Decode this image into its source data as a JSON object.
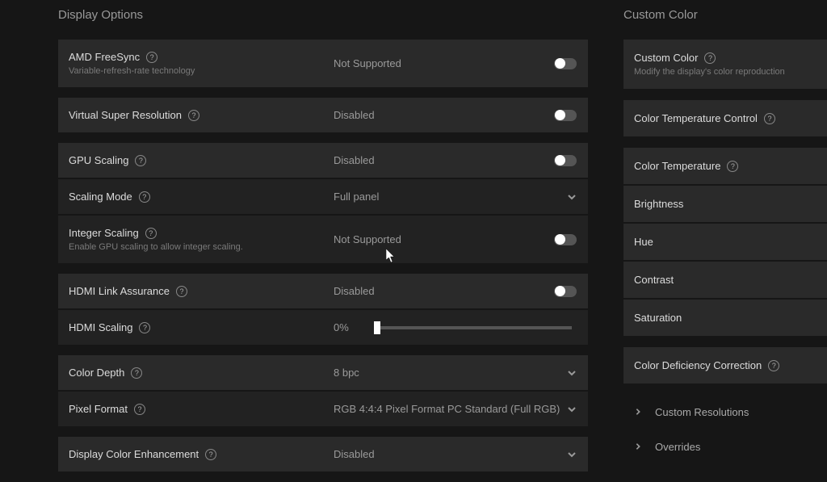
{
  "left": {
    "title": "Display Options",
    "groups": [
      {
        "rows": [
          {
            "label": "AMD FreeSync",
            "sub": "Variable-refresh-rate technology",
            "value": "Not Supported",
            "control": "toggle"
          }
        ]
      },
      {
        "rows": [
          {
            "label": "Virtual Super Resolution",
            "value": "Disabled",
            "control": "toggle"
          }
        ]
      },
      {
        "rows": [
          {
            "label": "GPU Scaling",
            "value": "Disabled",
            "control": "toggle"
          },
          {
            "label": "Scaling Mode",
            "value": "Full panel",
            "control": "dropdown",
            "subrow": true
          },
          {
            "label": "Integer Scaling",
            "sub": "Enable GPU scaling to allow integer scaling.",
            "value": "Not Supported",
            "control": "toggle",
            "subrow": true
          }
        ]
      },
      {
        "rows": [
          {
            "label": "HDMI Link Assurance",
            "value": "Disabled",
            "control": "toggle"
          },
          {
            "label": "HDMI Scaling",
            "value": "0%",
            "control": "slider",
            "subrow": true
          }
        ]
      },
      {
        "rows": [
          {
            "label": "Color Depth",
            "value": "8 bpc",
            "control": "dropdown"
          },
          {
            "label": "Pixel Format",
            "value": "RGB 4:4:4 Pixel Format PC Standard (Full RGB)",
            "control": "dropdown",
            "subrow": true
          }
        ]
      },
      {
        "rows": [
          {
            "label": "Display Color Enhancement",
            "value": "Disabled",
            "control": "dropdown"
          }
        ]
      }
    ]
  },
  "right": {
    "title": "Custom Color",
    "groups": [
      [
        {
          "label": "Custom Color",
          "sub": "Modify the display's color reproduction",
          "help": true
        }
      ],
      [
        {
          "label": "Color Temperature Control",
          "help": true
        }
      ],
      [
        {
          "label": "Color Temperature",
          "help": true
        },
        {
          "label": "Brightness"
        },
        {
          "label": "Hue"
        },
        {
          "label": "Contrast"
        },
        {
          "label": "Saturation"
        }
      ],
      [
        {
          "label": "Color Deficiency Correction",
          "help": true
        }
      ]
    ],
    "nav": [
      {
        "label": "Custom Resolutions"
      },
      {
        "label": "Overrides"
      }
    ]
  }
}
